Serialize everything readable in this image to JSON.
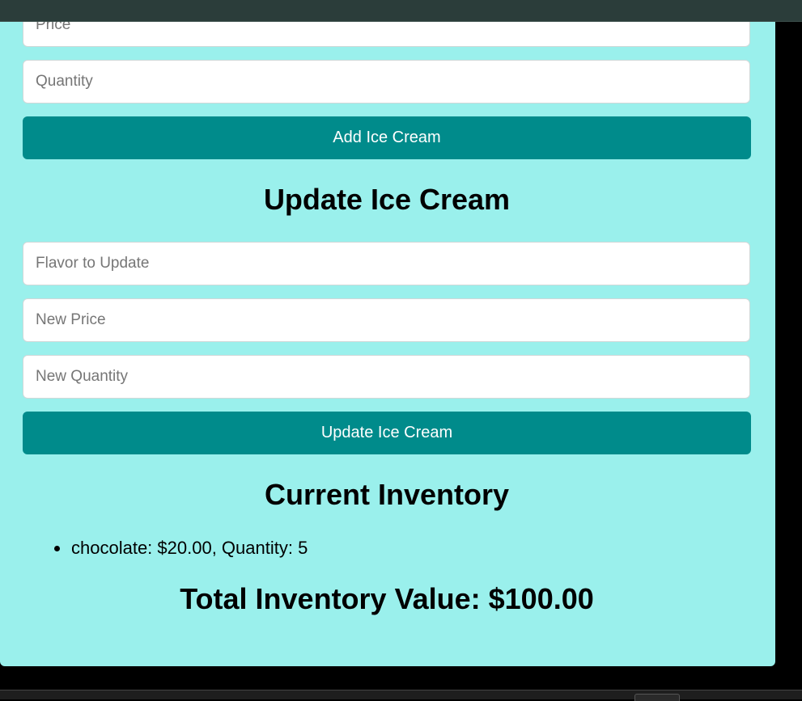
{
  "add_form": {
    "price_placeholder": "Price",
    "quantity_placeholder": "Quantity",
    "submit_label": "Add Ice Cream"
  },
  "update_form": {
    "heading": "Update Ice Cream",
    "flavor_placeholder": "Flavor to Update",
    "new_price_placeholder": "New Price",
    "new_quantity_placeholder": "New Quantity",
    "submit_label": "Update Ice Cream"
  },
  "inventory": {
    "heading": "Current Inventory",
    "items": [
      {
        "text": "chocolate: $20.00, Quantity: 5"
      }
    ],
    "total": "Total Inventory Value: $100.00"
  },
  "colors": {
    "panel_background": "#9af0ec",
    "button": "#008b8b",
    "top_bar": "#2b3d3a"
  }
}
